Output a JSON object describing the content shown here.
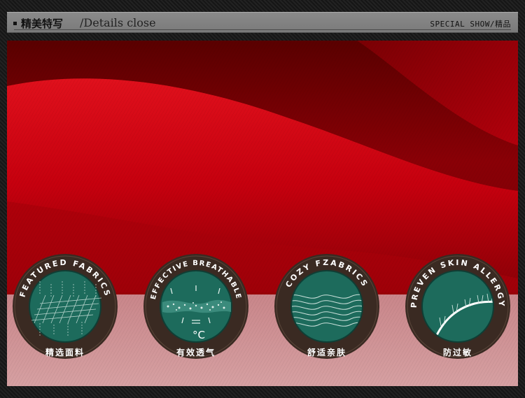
{
  "header": {
    "title_cn": "精美特写",
    "title_en": "/Details close",
    "right": "SPECIAL SHOW/精品"
  },
  "colors": {
    "fabric_red": "#c4000c",
    "badge_ring": "#3a2a22",
    "badge_face": "#1d6b5c"
  },
  "badges": [
    {
      "arc": "FEATURED FABRICS",
      "cn": "精选面料",
      "icon": "fabric-grid-icon"
    },
    {
      "arc": "EFFECTIVE BREATHABLE",
      "cn": "有效透气",
      "icon": "breathable-icon",
      "temp": "°C"
    },
    {
      "arc": "COZY FZABRICS",
      "cn": "舒适亲肤",
      "icon": "waves-icon"
    },
    {
      "arc": "PREVEN SKIN ALLERGY",
      "cn": "防过敏",
      "icon": "skin-hair-icon"
    }
  ]
}
